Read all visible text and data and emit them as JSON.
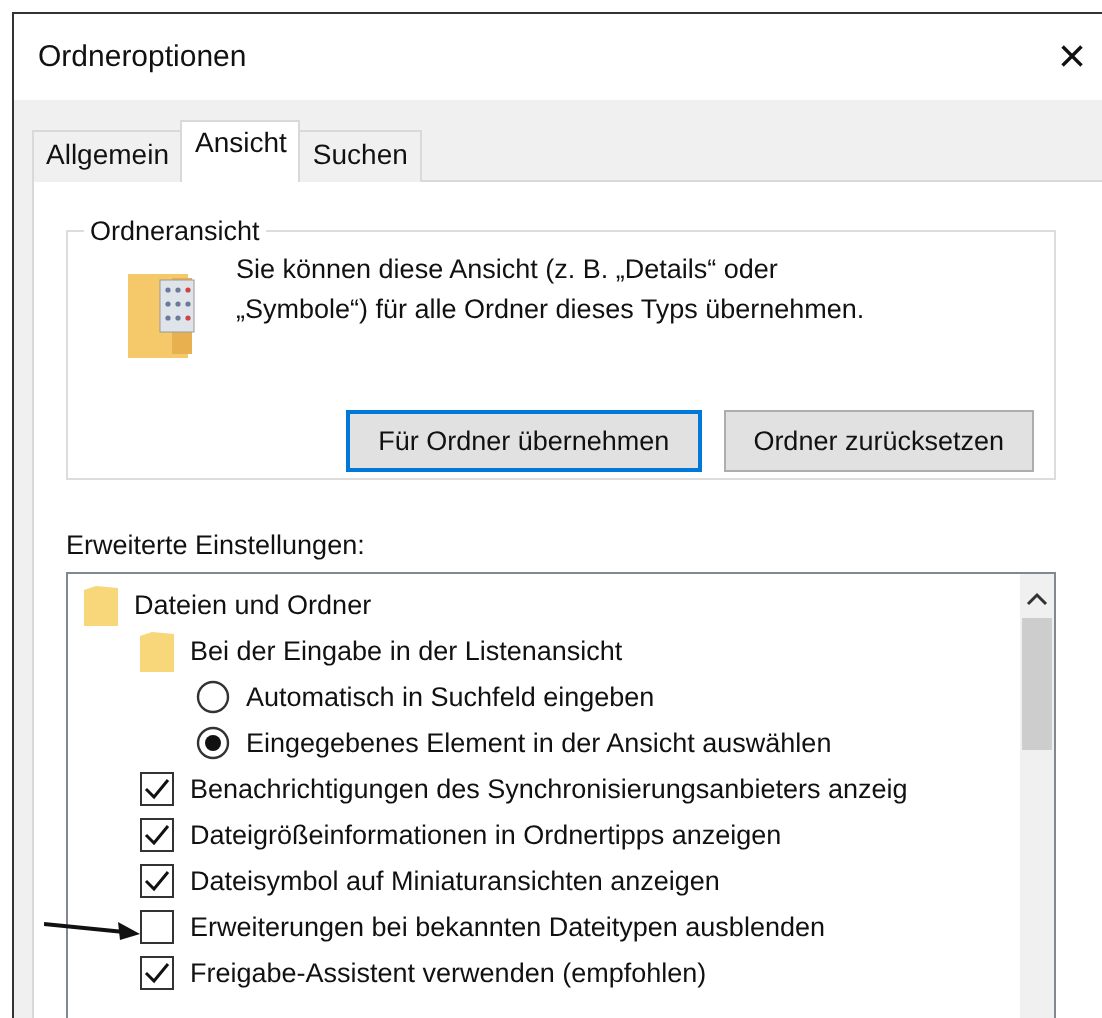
{
  "window": {
    "title": "Ordneroptionen",
    "close": "×"
  },
  "tabs": [
    {
      "label": "Allgemein",
      "selected": false
    },
    {
      "label": "Ansicht",
      "selected": true
    },
    {
      "label": "Suchen",
      "selected": false
    }
  ],
  "folder_view": {
    "title": "Ordneransicht",
    "text": "Sie können diese Ansicht (z. B. „Details“ oder „Symbole“) für alle Ordner dieses Typs übernehmen.",
    "buttons": [
      {
        "label": "Für Ordner übernehmen",
        "focused": true
      },
      {
        "label": "Ordner zurücksetzen",
        "focused": false
      }
    ]
  },
  "advanced": {
    "label": "Erweiterte Einstellungen:",
    "items": [
      {
        "kind": "folder",
        "label": "Dateien und Ordner",
        "children": [
          {
            "kind": "folder",
            "label": "Bei der Eingabe in der Listenansicht",
            "children": [
              {
                "kind": "radio",
                "label": "Automatisch in Suchfeld eingeben",
                "selected": false
              },
              {
                "kind": "radio",
                "label": "Eingegebenes Element in der Ansicht auswählen",
                "selected": true
              }
            ]
          },
          {
            "kind": "checkbox",
            "label": "Benachrichtigungen des Synchronisierungsanbieters anzeig",
            "checked": true
          },
          {
            "kind": "checkbox",
            "label": "Dateigrößeinformationen in Ordnertipps anzeigen",
            "checked": true
          },
          {
            "kind": "checkbox",
            "label": "Dateisymbol auf Miniaturansichten anzeigen",
            "checked": true
          },
          {
            "kind": "checkbox",
            "label": "Erweiterungen bei bekannten Dateitypen ausblenden",
            "checked": false,
            "pointer": true
          },
          {
            "kind": "checkbox",
            "label": "Freigabe-Assistent verwenden (empfohlen)",
            "checked": true
          }
        ]
      }
    ]
  }
}
